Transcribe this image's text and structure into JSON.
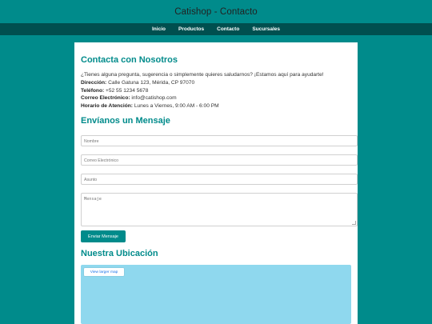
{
  "header": {
    "title": "Catishop - Contacto"
  },
  "nav": {
    "items": [
      "Inicio",
      "Productos",
      "Contacto",
      "Sucursales"
    ]
  },
  "contact": {
    "heading": "Contacta con Nosotros",
    "intro": "¿Tienes alguna pregunta, sugerencia o simplemente quieres saludarnos? ¡Estamos aquí para ayudarte!",
    "address_label": "Dirección:",
    "address": "Calle Gatuna 123, Mérida, CP 97070",
    "phone_label": "Teléfono:",
    "phone": "+52 55 1234 5678",
    "email_label": "Correo Electrónico:",
    "email": "info@catishop.com",
    "hours_label": "Horario de Atención:",
    "hours": "Lunes a Viernes, 9:00 AM - 6:00 PM"
  },
  "form": {
    "heading": "Envíanos un Mensaje",
    "name_placeholder": "Nombre",
    "email_placeholder": "Correo Electrónico",
    "subject_placeholder": "Asunto",
    "message_placeholder": "Mensaje",
    "submit_label": "Enviar Mensaje"
  },
  "location": {
    "heading": "Nuestra Ubicación",
    "map_button": "View larger map",
    "map_color": "#8fd8ee"
  }
}
